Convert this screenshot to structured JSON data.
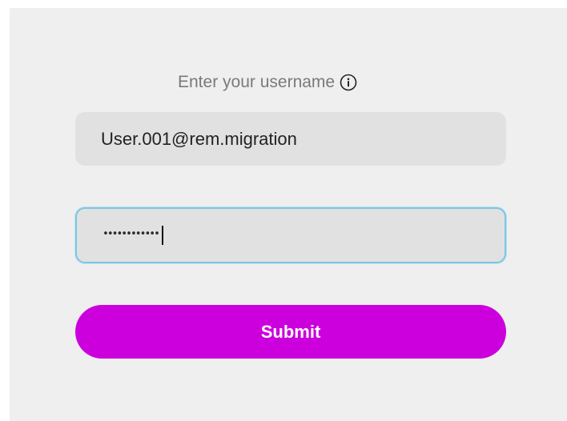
{
  "login": {
    "prompt_text": "Enter your username",
    "info_icon": "info-circle-icon",
    "username_value": "User.001@rem.migration",
    "password_mask": "••••••••••••",
    "submit_label": "Submit"
  },
  "colors": {
    "panel_background": "#efefef",
    "field_background": "#e1e1e1",
    "focus_border": "#7ec6e2",
    "submit_background": "#cc00dd",
    "submit_text": "#ffffff",
    "prompt_text": "#7a7a7a"
  }
}
